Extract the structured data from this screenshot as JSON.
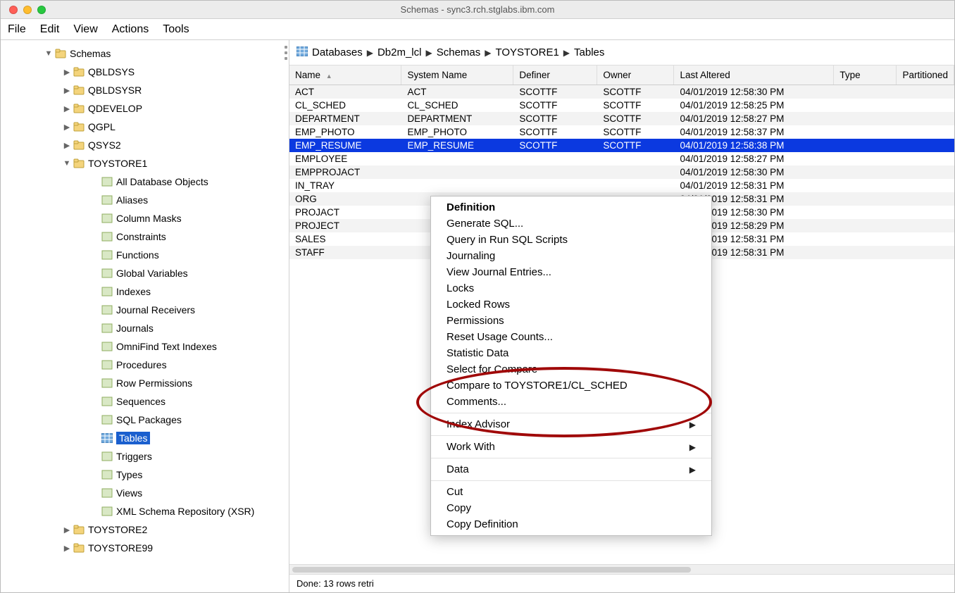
{
  "window": {
    "title": "Schemas - sync3.rch.stglabs.ibm.com"
  },
  "menubar": [
    "File",
    "Edit",
    "View",
    "Actions",
    "Tools"
  ],
  "tree": {
    "root": "Schemas",
    "schemas": [
      {
        "label": "QBLDSYS",
        "expanded": false
      },
      {
        "label": "QBLDSYSR",
        "expanded": false
      },
      {
        "label": "QDEVELOP",
        "expanded": false
      },
      {
        "label": "QGPL",
        "expanded": false
      },
      {
        "label": "QSYS2",
        "expanded": false
      },
      {
        "label": "TOYSTORE1",
        "expanded": true
      },
      {
        "label": "TOYSTORE2",
        "expanded": false
      },
      {
        "label": "TOYSTORE99",
        "expanded": false
      }
    ],
    "toystore_children": [
      "All Database Objects",
      "Aliases",
      "Column Masks",
      "Constraints",
      "Functions",
      "Global Variables",
      "Indexes",
      "Journal Receivers",
      "Journals",
      "OmniFind Text Indexes",
      "Procedures",
      "Row Permissions",
      "Sequences",
      "SQL Packages",
      "Tables",
      "Triggers",
      "Types",
      "Views",
      "XML Schema Repository (XSR)"
    ],
    "selected_child": "Tables"
  },
  "breadcrumb": [
    "Databases",
    "Db2m_lcl",
    "Schemas",
    "TOYSTORE1",
    "Tables"
  ],
  "table": {
    "columns": [
      "Name",
      "System Name",
      "Definer",
      "Owner",
      "Last Altered",
      "Type",
      "Partitioned"
    ],
    "sorted_column_index": 0,
    "rows": [
      {
        "name": "ACT",
        "sys": "ACT",
        "definer": "SCOTTF",
        "owner": "SCOTTF",
        "altered": "04/01/2019 12:58:30 PM"
      },
      {
        "name": "CL_SCHED",
        "sys": "CL_SCHED",
        "definer": "SCOTTF",
        "owner": "SCOTTF",
        "altered": "04/01/2019 12:58:25 PM"
      },
      {
        "name": "DEPARTMENT",
        "sys": "DEPARTMENT",
        "definer": "SCOTTF",
        "owner": "SCOTTF",
        "altered": "04/01/2019 12:58:27 PM"
      },
      {
        "name": "EMP_PHOTO",
        "sys": "EMP_PHOTO",
        "definer": "SCOTTF",
        "owner": "SCOTTF",
        "altered": "04/01/2019 12:58:37 PM"
      },
      {
        "name": "EMP_RESUME",
        "sys": "EMP_RESUME",
        "definer": "SCOTTF",
        "owner": "SCOTTF",
        "altered": "04/01/2019 12:58:38 PM",
        "selected": true
      },
      {
        "name": "EMPLOYEE",
        "sys": "",
        "definer": "",
        "owner": "",
        "altered": "04/01/2019 12:58:27 PM"
      },
      {
        "name": "EMPPROJACT",
        "sys": "",
        "definer": "",
        "owner": "",
        "altered": "04/01/2019 12:58:30 PM"
      },
      {
        "name": "IN_TRAY",
        "sys": "",
        "definer": "",
        "owner": "",
        "altered": "04/01/2019 12:58:31 PM"
      },
      {
        "name": "ORG",
        "sys": "",
        "definer": "",
        "owner": "",
        "altered": "04/01/2019 12:58:31 PM"
      },
      {
        "name": "PROJACT",
        "sys": "",
        "definer": "",
        "owner": "",
        "altered": "04/01/2019 12:58:30 PM"
      },
      {
        "name": "PROJECT",
        "sys": "",
        "definer": "",
        "owner": "",
        "altered": "04/01/2019 12:58:29 PM"
      },
      {
        "name": "SALES",
        "sys": "",
        "definer": "",
        "owner": "",
        "altered": "04/01/2019 12:58:31 PM"
      },
      {
        "name": "STAFF",
        "sys": "",
        "definer": "",
        "owner": "",
        "altered": "04/01/2019 12:58:31 PM"
      }
    ]
  },
  "status": "Done: 13 rows retri",
  "context_menu": {
    "items": [
      {
        "label": "Definition",
        "bold": true
      },
      {
        "label": "Generate SQL..."
      },
      {
        "label": "Query in Run SQL Scripts"
      },
      {
        "label": "Journaling"
      },
      {
        "label": "View Journal Entries..."
      },
      {
        "label": "Locks"
      },
      {
        "label": "Locked Rows"
      },
      {
        "label": "Permissions"
      },
      {
        "label": "Reset Usage Counts..."
      },
      {
        "label": "Statistic Data"
      },
      {
        "label": "Select for Compare"
      },
      {
        "label": "Compare to TOYSTORE1/CL_SCHED"
      },
      {
        "label": "Comments..."
      },
      {
        "sep": true
      },
      {
        "label": "Index Advisor",
        "submenu": true
      },
      {
        "sep": true
      },
      {
        "label": "Work With",
        "submenu": true
      },
      {
        "sep": true
      },
      {
        "label": "Data",
        "submenu": true
      },
      {
        "sep": true
      },
      {
        "label": "Cut"
      },
      {
        "label": "Copy"
      },
      {
        "label": "Copy Definition"
      }
    ]
  }
}
